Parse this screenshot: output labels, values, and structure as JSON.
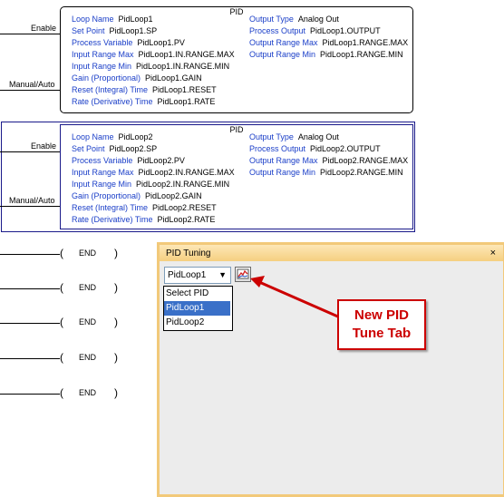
{
  "rung1": {
    "enable_label": "Enable",
    "manual_label": "Manual/Auto",
    "title": "PID",
    "left": [
      {
        "key": "Loop Name",
        "value": "PidLoop1"
      },
      {
        "key": "Set Point",
        "value": "PidLoop1.SP"
      },
      {
        "key": "Process Variable",
        "value": "PidLoop1.PV"
      },
      {
        "key": "Input Range Max",
        "value": "PidLoop1.IN.RANGE.MAX"
      },
      {
        "key": "Input Range Min",
        "value": "PidLoop1.IN.RANGE.MIN"
      },
      {
        "key": "Gain (Proportional)",
        "value": "PidLoop1.GAIN"
      },
      {
        "key": "Reset (Integral) Time",
        "value": "PidLoop1.RESET"
      },
      {
        "key": "Rate (Derivative) Time",
        "value": "PidLoop1.RATE"
      }
    ],
    "right": [
      {
        "key": "Output Type",
        "value": "Analog Out"
      },
      {
        "key": "Process Output",
        "value": "PidLoop1.OUTPUT"
      },
      {
        "key": "Output Range Max",
        "value": "PidLoop1.RANGE.MAX"
      },
      {
        "key": "Output Range Min",
        "value": "PidLoop1.RANGE.MIN"
      }
    ]
  },
  "rung2": {
    "enable_label": "Enable",
    "manual_label": "Manual/Auto",
    "title": "PID",
    "left": [
      {
        "key": "Loop Name",
        "value": "PidLoop2"
      },
      {
        "key": "Set Point",
        "value": "PidLoop2.SP"
      },
      {
        "key": "Process Variable",
        "value": "PidLoop2.PV"
      },
      {
        "key": "Input Range Max",
        "value": "PidLoop2.IN.RANGE.MAX"
      },
      {
        "key": "Input Range Min",
        "value": "PidLoop2.IN.RANGE.MIN"
      },
      {
        "key": "Gain (Proportional)",
        "value": "PidLoop2.GAIN"
      },
      {
        "key": "Reset (Integral) Time",
        "value": "PidLoop2.RESET"
      },
      {
        "key": "Rate (Derivative) Time",
        "value": "PidLoop2.RATE"
      }
    ],
    "right": [
      {
        "key": "Output Type",
        "value": "Analog Out"
      },
      {
        "key": "Process Output",
        "value": "PidLoop2.OUTPUT"
      },
      {
        "key": "Output Range Max",
        "value": "PidLoop2.RANGE.MAX"
      },
      {
        "key": "Output Range Min",
        "value": "PidLoop2.RANGE.MIN"
      }
    ]
  },
  "end_rungs": [
    {
      "label": "END"
    },
    {
      "label": "END"
    },
    {
      "label": "END"
    },
    {
      "label": "END"
    },
    {
      "label": "END"
    }
  ],
  "panel": {
    "title": "PID Tuning",
    "close_glyph": "×",
    "selected_loop": "PidLoop1",
    "dropdown_arrow": "▼",
    "tune_button_icon": "pid-tune-chart-icon",
    "options": [
      {
        "label": "Select PID",
        "active": false
      },
      {
        "label": "PidLoop1",
        "active": true
      },
      {
        "label": "PidLoop2",
        "active": false
      }
    ]
  },
  "callout": {
    "text": "New PID\nTune Tab",
    "color": "#cc0000"
  },
  "colors": {
    "param_key": "#1a3ec8",
    "selection": "#1a1a8a",
    "panel_border": "#f2c97a",
    "highlight": "#3a70c8"
  }
}
